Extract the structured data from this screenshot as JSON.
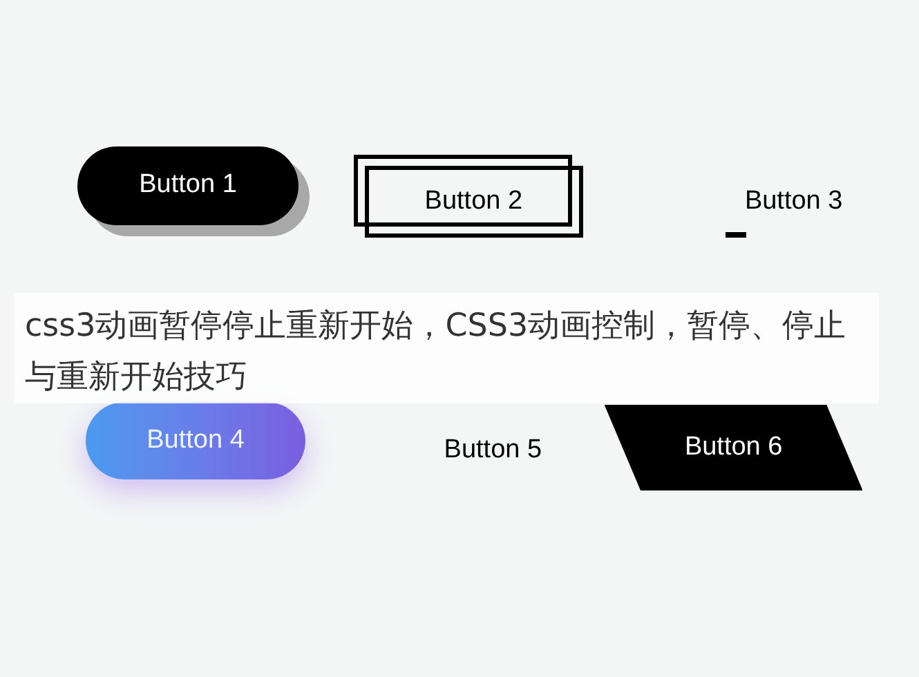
{
  "title": "css3动画暂停停止重新开始，CSS3动画控制，暂停、停止与重新开始技巧",
  "buttons": [
    {
      "label": "Button 1",
      "kind": "shadow-pill"
    },
    {
      "label": "Button 2",
      "kind": "double-frame"
    },
    {
      "label": "Button 3",
      "kind": "underline"
    },
    {
      "label": "Button 4",
      "kind": "gradient-pill"
    },
    {
      "label": "Button 5",
      "kind": "plain"
    },
    {
      "label": "Button 6",
      "kind": "parallelogram"
    }
  ]
}
